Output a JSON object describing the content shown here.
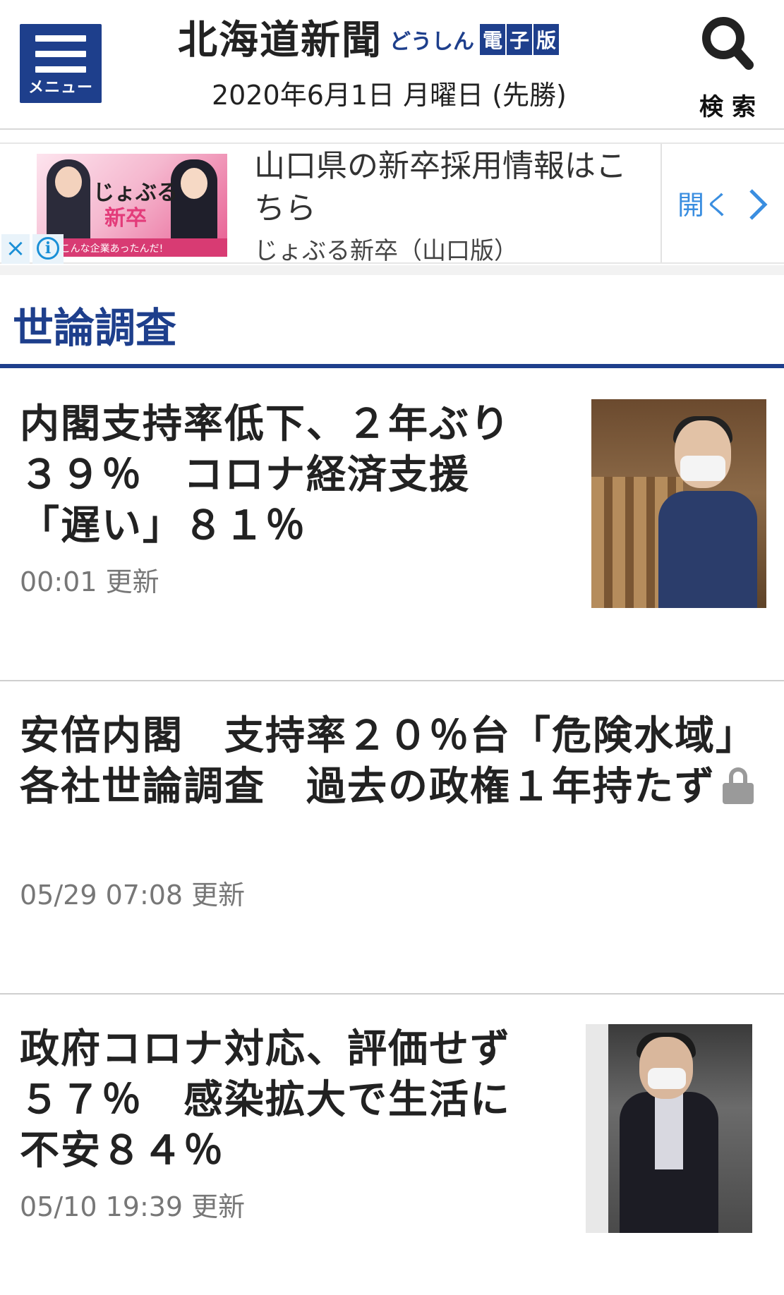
{
  "header": {
    "menu_label": "メニュー",
    "brand_main": "北海道新聞",
    "brand_sub": "どうしん",
    "brand_edition": [
      "電",
      "子",
      "版"
    ],
    "date": "2020年6月1日 月曜日 (先勝)",
    "search_label": "検索",
    "accent_color": "#1e3f8c"
  },
  "ad": {
    "image_text_top": "じょぶる",
    "image_text_bottom": "新卒",
    "image_strip": "に、こんな企業あったんだ!",
    "headline": "山口県の新卒採用情報はこちら",
    "source": "じょぶる新卒（山口版）",
    "open_label": "開く",
    "close_icon": "×",
    "info_icon": "i"
  },
  "section": {
    "title": "世論調査"
  },
  "articles": [
    {
      "title": "内閣支持率低下、２年ぶり３９％　コロナ経済支援「遅い」８１％",
      "meta": "00:01 更新",
      "locked": false,
      "has_thumbnail": true
    },
    {
      "title": "安倍内閣　支持率２０％台「危険水域」　各社世論調査　過去の政権１年持たず",
      "meta": "05/29 07:08 更新",
      "locked": true,
      "has_thumbnail": false
    },
    {
      "title": "政府コロナ対応、評価せず５７％　感染拡大で生活に不安８４％",
      "meta": "05/10 19:39 更新",
      "locked": false,
      "has_thumbnail": true
    }
  ]
}
